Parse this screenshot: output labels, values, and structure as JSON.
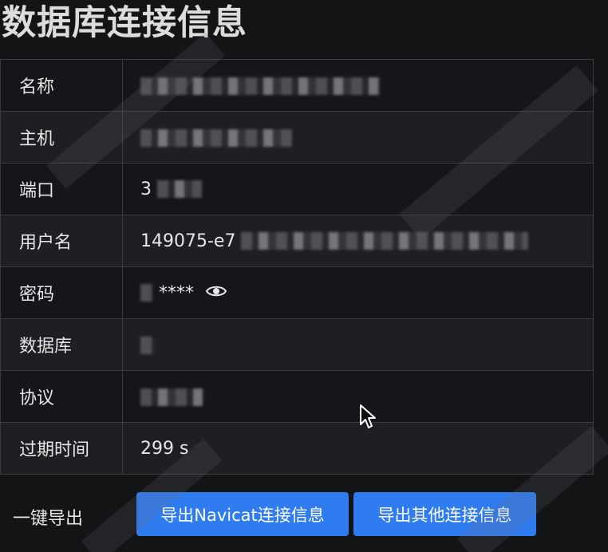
{
  "page": {
    "title": "数据库连接信息"
  },
  "rows": [
    {
      "label": "名称",
      "value": ""
    },
    {
      "label": "主机",
      "value": ""
    },
    {
      "label": "端口",
      "value": "3"
    },
    {
      "label": "用户名",
      "value": "149075-e7"
    },
    {
      "label": "密码",
      "value": "****"
    },
    {
      "label": "数据库",
      "value": ""
    },
    {
      "label": "协议",
      "value": ""
    },
    {
      "label": "过期时间",
      "value": "299 s"
    }
  ],
  "export": {
    "label": "一键导出",
    "navicat_button": "导出Navicat连接信息",
    "other_button": "导出其他连接信息"
  },
  "icons": {
    "password_toggle": "eye-icon",
    "cursor": "mouse-pointer-icon"
  },
  "colors": {
    "background": "#131416",
    "button": "#2f7bf0",
    "border": "#3a3c40"
  }
}
